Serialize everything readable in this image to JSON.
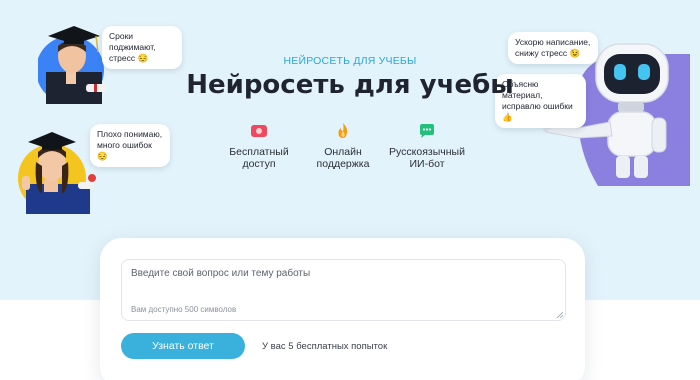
{
  "hero": {
    "eyebrow": "НЕЙРОСЕТЬ ДЛЯ УЧЕБЫ",
    "title": "Нейросеть для учебы"
  },
  "features": [
    {
      "icon": "money-icon",
      "label": "Бесплатный\nдоступ"
    },
    {
      "icon": "flame-icon",
      "label": "Онлайн\nподдержка"
    },
    {
      "icon": "chat-icon",
      "label": "Русскоязычный\nИИ-бот"
    }
  ],
  "bubbles": {
    "graduate": "Сроки поджимают,\nстресс 😔",
    "student": "Плохо понимаю,\nмного ошибок 😔",
    "robot_top": "Ускорю написание,\nснижу стресс 😉",
    "robot_bottom": "Объясню материал,\nисправлю ошибки 👍"
  },
  "form": {
    "placeholder": "Введите свой вопрос или тему работы",
    "limit_note": "Вам доступно 500 символов",
    "submit_label": "Узнать ответ",
    "attempts_text": "У вас 5 бесплатных попыток"
  },
  "colors": {
    "hero_bg": "#e3f3fb",
    "accent": "#3ab0dd",
    "eyebrow": "#2aa7da"
  }
}
